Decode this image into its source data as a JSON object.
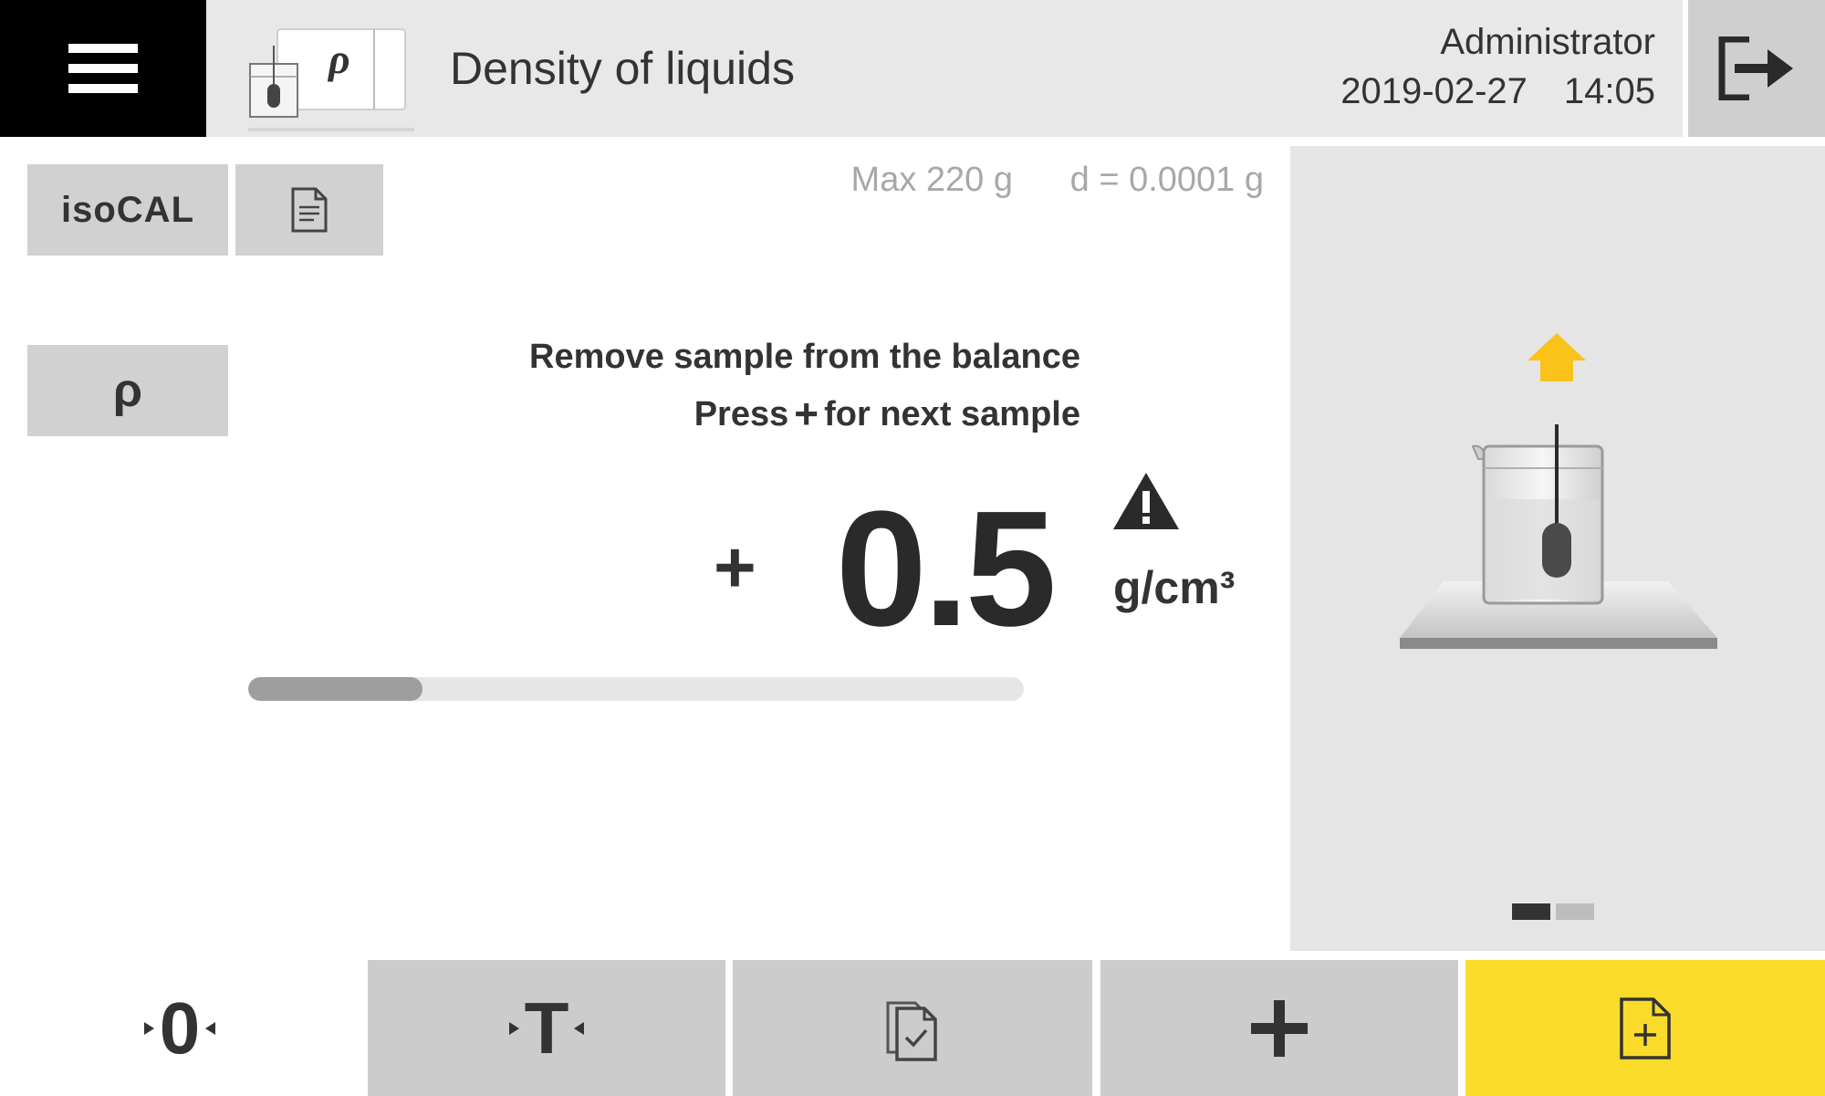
{
  "header": {
    "app_title": "Density of liquids",
    "app_icon_symbol": "ρ",
    "user": "Administrator",
    "date": "2019-02-27",
    "time": "14:05"
  },
  "left_buttons": {
    "isocal_label": "isoCAL",
    "density_label": "ρ"
  },
  "balance_specs": {
    "max": "Max 220 g",
    "readability": "d = 0.0001 g"
  },
  "messages": {
    "line1": "Remove sample from the balance",
    "line2_before": "Press",
    "line2_symbol": "+",
    "line2_after": "for next sample"
  },
  "reading": {
    "sign": "+",
    "value": "0.5",
    "unit": "g/cm³",
    "progress_percent": 22.5
  },
  "toolbar": {
    "zero_label": "0",
    "tare_label": "T"
  },
  "pager": {
    "pages": 2,
    "active": 1
  },
  "colors": {
    "header_bg": "#e8e8e8",
    "menu_bg": "#000000",
    "button_bg": "#d1d1d1",
    "accent_yellow": "#fadb2a",
    "arrow_yellow": "#fbc21a",
    "text_dark": "#333333",
    "text_muted": "#a8a8a8"
  },
  "icons": {
    "menu": "hamburger-icon",
    "app": "density-beaker-icon",
    "logout": "logout-icon",
    "report": "document-icon",
    "warning": "warning-triangle-icon",
    "check": "checklist-copy-icon",
    "new_sample": "new-document-icon"
  }
}
